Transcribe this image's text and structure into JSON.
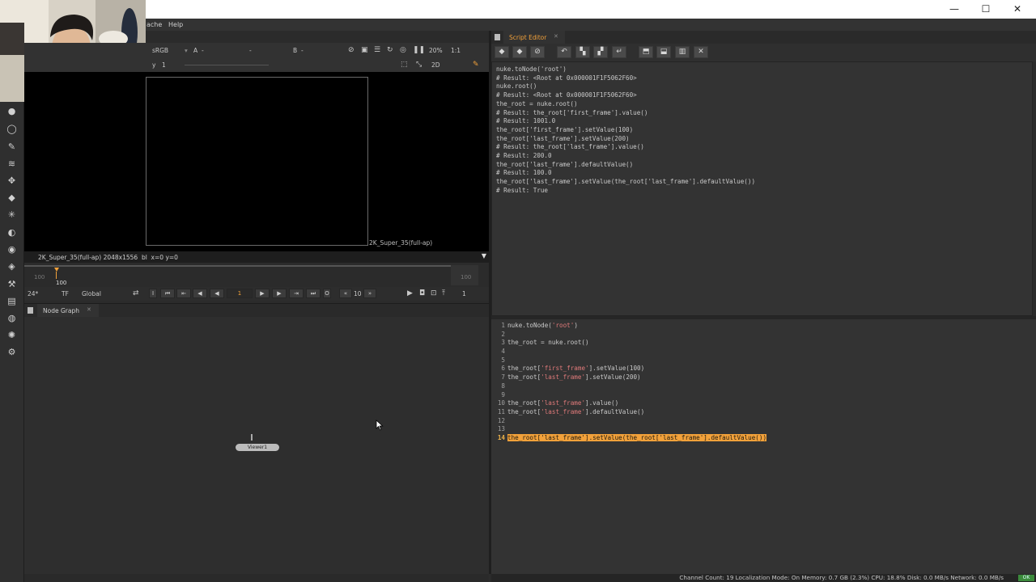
{
  "window": {
    "controls": {
      "minimize": "—",
      "maximize": "☐",
      "close": "✕"
    }
  },
  "menubar": {
    "items": [
      "ache",
      "Help"
    ]
  },
  "viewer": {
    "colorspace": "sRGB",
    "input_a": "A",
    "input_a_value": "-",
    "input_mid": "-",
    "input_b": "B",
    "input_b_value": "-",
    "zoom": "20%",
    "ratio": "1:1",
    "y_label": "y",
    "y_value": "1",
    "view_mode": "2D",
    "format_label": "2K_Super_35(full-ap)",
    "info_text": "2K_Super_35(full-ap) 2048x1556  bl  x=0 y=0"
  },
  "timeline": {
    "start": "100",
    "marker": "100",
    "end": "100"
  },
  "playback": {
    "fps": "24*",
    "tf": "TF",
    "scope": "Global",
    "current_frame": "1",
    "step": "10",
    "right_value": "1"
  },
  "node_graph": {
    "tab_label": "Node Graph",
    "node_label": "Viewer1"
  },
  "script_editor": {
    "tab_label": "Script Editor",
    "output_lines": [
      "nuke.toNode('root')",
      "# Result: <Root at 0x000001F1F5062F60>",
      "nuke.root()",
      "# Result: <Root at 0x000001F1F5062F60>",
      "the_root = nuke.root()",
      "# Result: the_root['first_frame'].value()",
      "# Result: 1001.0",
      "the_root['first_frame'].setValue(100)",
      "the_root['last_frame'].setValue(200)",
      "# Result: the_root['last_frame'].value()",
      "# Result: 200.0",
      "the_root['last_frame'].defaultValue()",
      "# Result: 100.0",
      "the_root['last_frame'].setValue(the_root['last_frame'].defaultValue())",
      "# Result: True"
    ],
    "input_lines": [
      {
        "n": "1",
        "code": "nuke.toNode('root')"
      },
      {
        "n": "2",
        "code": ""
      },
      {
        "n": "3",
        "code": "the_root = nuke.root()"
      },
      {
        "n": "4",
        "code": ""
      },
      {
        "n": "5",
        "code": ""
      },
      {
        "n": "6",
        "code": "the_root['first_frame'].setValue(100)"
      },
      {
        "n": "7",
        "code": "the_root['last_frame'].setValue(200)"
      },
      {
        "n": "8",
        "code": ""
      },
      {
        "n": "9",
        "code": ""
      },
      {
        "n": "10",
        "code": "the_root['last_frame'].value()"
      },
      {
        "n": "11",
        "code": "the_root['last_frame'].defaultValue()"
      },
      {
        "n": "12",
        "code": ""
      },
      {
        "n": "13",
        "code": ""
      },
      {
        "n": "14",
        "code": "the_root['last_frame'].setValue(the_root['last_frame'].defaultValue())",
        "current": true
      }
    ]
  },
  "statusbar": {
    "text": "Channel Count: 19  Localization Mode: On  Memory: 0.7 GB (2.3%)  CPU: 18.8%  Disk: 0.0 MB/s  Network: 0.0 MB/s",
    "ok": "OK"
  },
  "colors": {
    "accent": "#f2a13a",
    "string_color": "#e07a7a",
    "background": "#2b2b2b"
  }
}
